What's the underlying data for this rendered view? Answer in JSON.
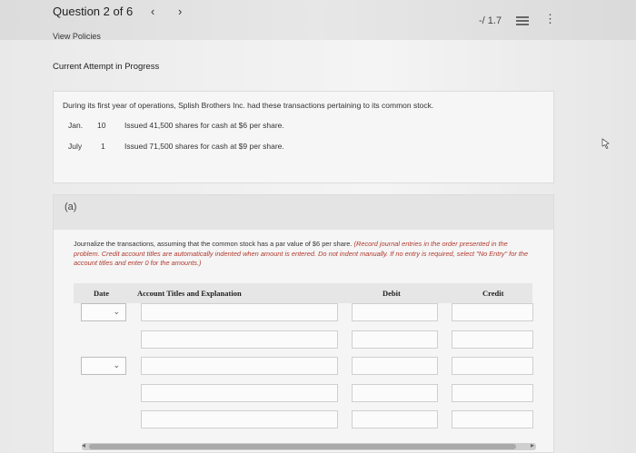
{
  "header": {
    "question_label": "Question 2 of 6",
    "prev_icon": "chevron-left-icon",
    "next_icon": "chevron-right-icon",
    "score": "-/ 1.7",
    "list_icon": "list-icon",
    "more_icon": "more-vertical-icon",
    "policies_link": "View Policies",
    "attempt_status": "Current Attempt in Progress"
  },
  "problem": {
    "intro": "During its first year of operations, Splish Brothers Inc. had these transactions pertaining to its common stock.",
    "transactions": [
      {
        "month": "Jan.",
        "day": "10",
        "text": "Issued 41,500 shares for cash at $6 per share."
      },
      {
        "month": "July",
        "day": "1",
        "text": "Issued 71,500 shares for cash at $9 per share."
      }
    ]
  },
  "part_a": {
    "label": "(a)",
    "instruction": "Journalize the transactions, assuming that the common stock has a par value of $6 per share.",
    "instruction_note": "(Record journal entries in the order presented in the problem. Credit account titles are automatically indented when amount is entered. Do not indent manually. If no entry is required, select \"No Entry\" for the account titles and enter 0 for the amounts.)",
    "columns": {
      "date": "Date",
      "account": "Account Titles and Explanation",
      "debit": "Debit",
      "credit": "Credit"
    }
  },
  "colors": {
    "note_red": "#b03a2e",
    "panel": "#f5f5f5",
    "header_band": "#e4e4e4"
  }
}
